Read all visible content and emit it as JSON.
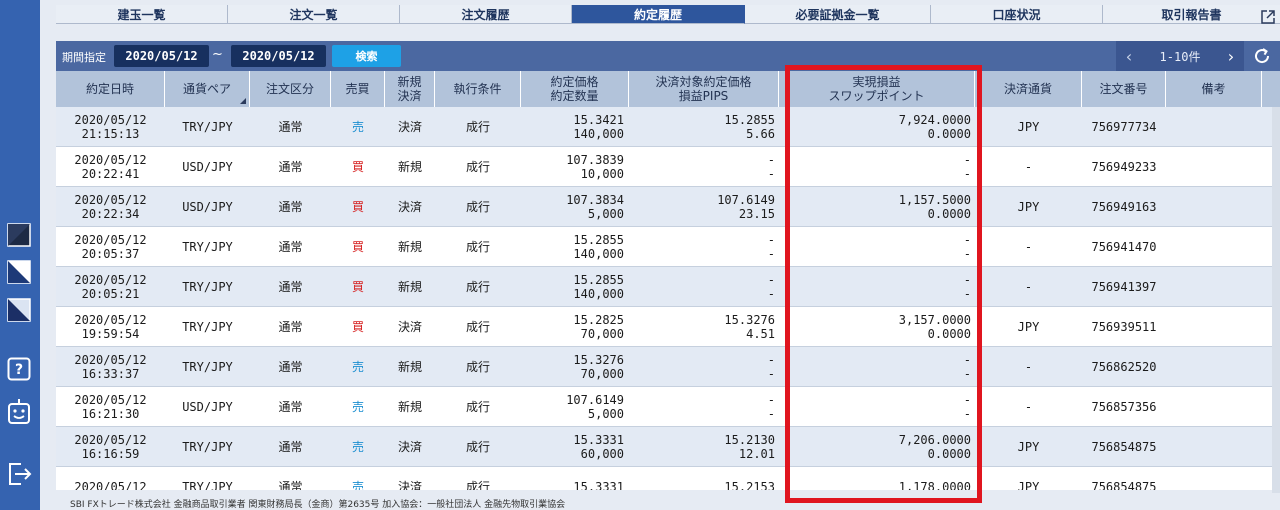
{
  "tabs": [
    {
      "label": "建玉一覧"
    },
    {
      "label": "注文一覧"
    },
    {
      "label": "注文履歴"
    },
    {
      "label": "約定履歴"
    },
    {
      "label": "必要証拠金一覧"
    },
    {
      "label": "口座状況"
    },
    {
      "label": "取引報告書"
    }
  ],
  "active_tab": "約定履歴",
  "filter": {
    "label": "期間指定",
    "date_from": "2020/05/12",
    "separator": "~",
    "date_to": "2020/05/12",
    "search_label": "検索"
  },
  "pager": {
    "range": "1-10件"
  },
  "columns": {
    "exec_datetime": "約定日時",
    "pair": "通貨ペア",
    "order_type": "注文区分",
    "side": "売買",
    "new_settle_1": "新規",
    "new_settle_2": "決済",
    "exec_cond": "執行条件",
    "price_1": "約定価格",
    "price_2": "約定数量",
    "settle_1": "決済対象約定価格",
    "settle_2": "損益PIPS",
    "pnl_1": "実現損益",
    "pnl_2": "スワップポイント",
    "currency": "決済通貨",
    "order_no": "注文番号",
    "remarks": "備考"
  },
  "rows": [
    {
      "date": "2020/05/12",
      "time": "21:15:13",
      "pair": "TRY/JPY",
      "type": "通常",
      "side": "売",
      "side_kind": "sell",
      "ns": "決済",
      "cond": "成行",
      "price": "15.3421",
      "qty": "140,000",
      "sprice": "15.2855",
      "pips": "5.66",
      "pnl": "7,924.0000",
      "swap": "0.0000",
      "cur": "JPY",
      "no": "756977734"
    },
    {
      "date": "2020/05/12",
      "time": "20:22:41",
      "pair": "USD/JPY",
      "type": "通常",
      "side": "買",
      "side_kind": "buy",
      "ns": "新規",
      "cond": "成行",
      "price": "107.3839",
      "qty": "10,000",
      "sprice": "-",
      "pips": "-",
      "pnl": "-",
      "swap": "-",
      "cur": "-",
      "no": "756949233"
    },
    {
      "date": "2020/05/12",
      "time": "20:22:34",
      "pair": "USD/JPY",
      "type": "通常",
      "side": "買",
      "side_kind": "buy",
      "ns": "決済",
      "cond": "成行",
      "price": "107.3834",
      "qty": "5,000",
      "sprice": "107.6149",
      "pips": "23.15",
      "pnl": "1,157.5000",
      "swap": "0.0000",
      "cur": "JPY",
      "no": "756949163"
    },
    {
      "date": "2020/05/12",
      "time": "20:05:37",
      "pair": "TRY/JPY",
      "type": "通常",
      "side": "買",
      "side_kind": "buy",
      "ns": "新規",
      "cond": "成行",
      "price": "15.2855",
      "qty": "140,000",
      "sprice": "-",
      "pips": "-",
      "pnl": "-",
      "swap": "-",
      "cur": "-",
      "no": "756941470"
    },
    {
      "date": "2020/05/12",
      "time": "20:05:21",
      "pair": "TRY/JPY",
      "type": "通常",
      "side": "買",
      "side_kind": "buy",
      "ns": "新規",
      "cond": "成行",
      "price": "15.2855",
      "qty": "140,000",
      "sprice": "-",
      "pips": "-",
      "pnl": "-",
      "swap": "-",
      "cur": "-",
      "no": "756941397"
    },
    {
      "date": "2020/05/12",
      "time": "19:59:54",
      "pair": "TRY/JPY",
      "type": "通常",
      "side": "買",
      "side_kind": "buy",
      "ns": "決済",
      "cond": "成行",
      "price": "15.2825",
      "qty": "70,000",
      "sprice": "15.3276",
      "pips": "4.51",
      "pnl": "3,157.0000",
      "swap": "0.0000",
      "cur": "JPY",
      "no": "756939511"
    },
    {
      "date": "2020/05/12",
      "time": "16:33:37",
      "pair": "TRY/JPY",
      "type": "通常",
      "side": "売",
      "side_kind": "sell",
      "ns": "新規",
      "cond": "成行",
      "price": "15.3276",
      "qty": "70,000",
      "sprice": "-",
      "pips": "-",
      "pnl": "-",
      "swap": "-",
      "cur": "-",
      "no": "756862520"
    },
    {
      "date": "2020/05/12",
      "time": "16:21:30",
      "pair": "USD/JPY",
      "type": "通常",
      "side": "売",
      "side_kind": "sell",
      "ns": "新規",
      "cond": "成行",
      "price": "107.6149",
      "qty": "5,000",
      "sprice": "-",
      "pips": "-",
      "pnl": "-",
      "swap": "-",
      "cur": "-",
      "no": "756857356"
    },
    {
      "date": "2020/05/12",
      "time": "16:16:59",
      "pair": "TRY/JPY",
      "type": "通常",
      "side": "売",
      "side_kind": "sell",
      "ns": "決済",
      "cond": "成行",
      "price": "15.3331",
      "qty": "60,000",
      "sprice": "15.2130",
      "pips": "12.01",
      "pnl": "7,206.0000",
      "swap": "0.0000",
      "cur": "JPY",
      "no": "756854875"
    },
    {
      "date": "2020/05/12",
      "time": "",
      "pair": "TRY/JPY",
      "type": "通常",
      "side": "売",
      "side_kind": "sell",
      "ns": "決済",
      "cond": "成行",
      "price": "15.3331",
      "qty": "",
      "sprice": "15.2153",
      "pips": "",
      "pnl": "1,178.0000",
      "swap": "",
      "cur": "JPY",
      "no": "756854875"
    }
  ],
  "footer": "SBI FXトレード株式会社 金融商品取引業者 関東財務局長（金商）第2635号 加入協会：一般社団法人 金融先物取引業協会",
  "colors": {
    "accent": "#2e569d",
    "buy": "#d62020",
    "sell": "#1c8fd1",
    "highlight": "#e0151f"
  },
  "icons": [
    "theme-dark-icon",
    "theme-split-icon",
    "theme-diagonal-icon",
    "help-icon",
    "robot-icon",
    "logout-icon",
    "external-link-icon",
    "refresh-icon"
  ]
}
